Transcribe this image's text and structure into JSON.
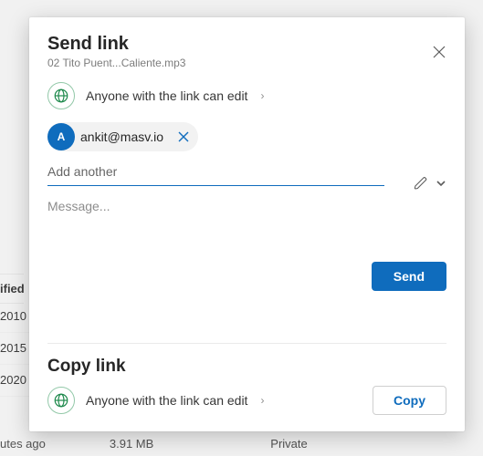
{
  "bg": {
    "header": "ified",
    "rows": [
      "2010",
      "2015",
      "2020"
    ],
    "footer": {
      "time": "utes ago",
      "size": "3.91 MB",
      "share": "Private"
    }
  },
  "dialog": {
    "title": "Send link",
    "subtitle": "02 Tito Puent...Caliente.mp3",
    "permission": "Anyone with the link can edit",
    "chip": {
      "initial": "A",
      "email": "ankit@masv.io"
    },
    "add_placeholder": "Add another",
    "msg_placeholder": "Message...",
    "send_label": "Send"
  },
  "copy": {
    "title": "Copy link",
    "permission": "Anyone with the link can edit",
    "button": "Copy"
  }
}
